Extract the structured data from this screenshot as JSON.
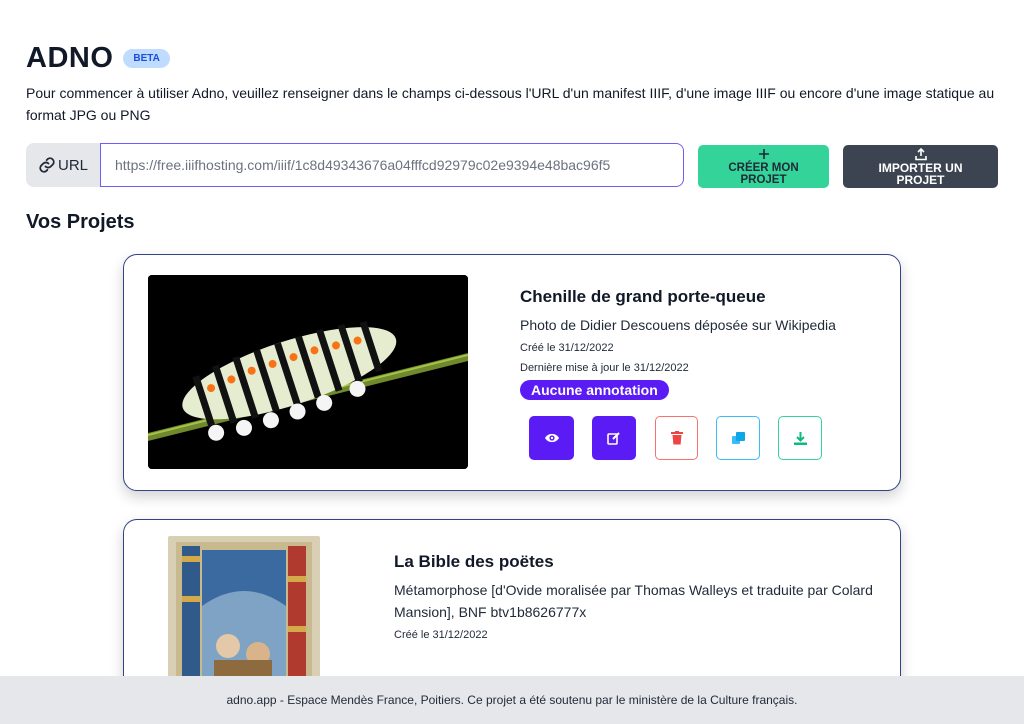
{
  "header": {
    "title": "ADNO",
    "badge": "BETA",
    "intro": "Pour commencer à utiliser Adno, veuillez renseigner dans le champs ci-dessous l'URL d'un manifest IIIF, d'une image IIIF ou encore d'une image statique au format JPG ou PNG"
  },
  "url_form": {
    "addon_label": "URL",
    "input_value": "https://free.iiifhosting.com/iiif/1c8d49343676a04fffcd92979c02e9394e48bac96f5",
    "create_label": "CRÉER MON PROJET",
    "import_label": "IMPORTER UN PROJET"
  },
  "projects_section": {
    "title": "Vos Projets"
  },
  "projects": [
    {
      "title": "Chenille de grand porte-queue",
      "description": "Photo de Didier Descouens déposée sur Wikipedia",
      "created": "Créé le 31/12/2022",
      "updated": "Dernière mise à jour le 31/12/2022",
      "annotation_badge": "Aucune annotation"
    },
    {
      "title": "La Bible des poëtes",
      "description": "Métamorphose [d'Ovide moralisée par Thomas Walleys et traduite par Colard Mansion], BNF btv1b8626777x",
      "created": "Créé le 31/12/2022"
    }
  ],
  "icons": {
    "link": "link-icon",
    "plus": "plus-icon",
    "upload": "upload-icon",
    "view": "eye-icon",
    "edit": "edit-icon",
    "delete": "trash-icon",
    "duplicate": "copy-icon",
    "download": "download-icon"
  },
  "colors": {
    "badge_bg": "#bfdbfe",
    "create_button": "#34d399",
    "import_button": "#3d4451",
    "primary": "#5b1bf5",
    "danger": "#f87171",
    "info": "#38bdf8",
    "success": "#34d399",
    "card_border": "#314485"
  },
  "footer": {
    "text": "adno.app - Espace Mendès France, Poitiers. Ce projet a été soutenu par le ministère de la Culture français."
  }
}
